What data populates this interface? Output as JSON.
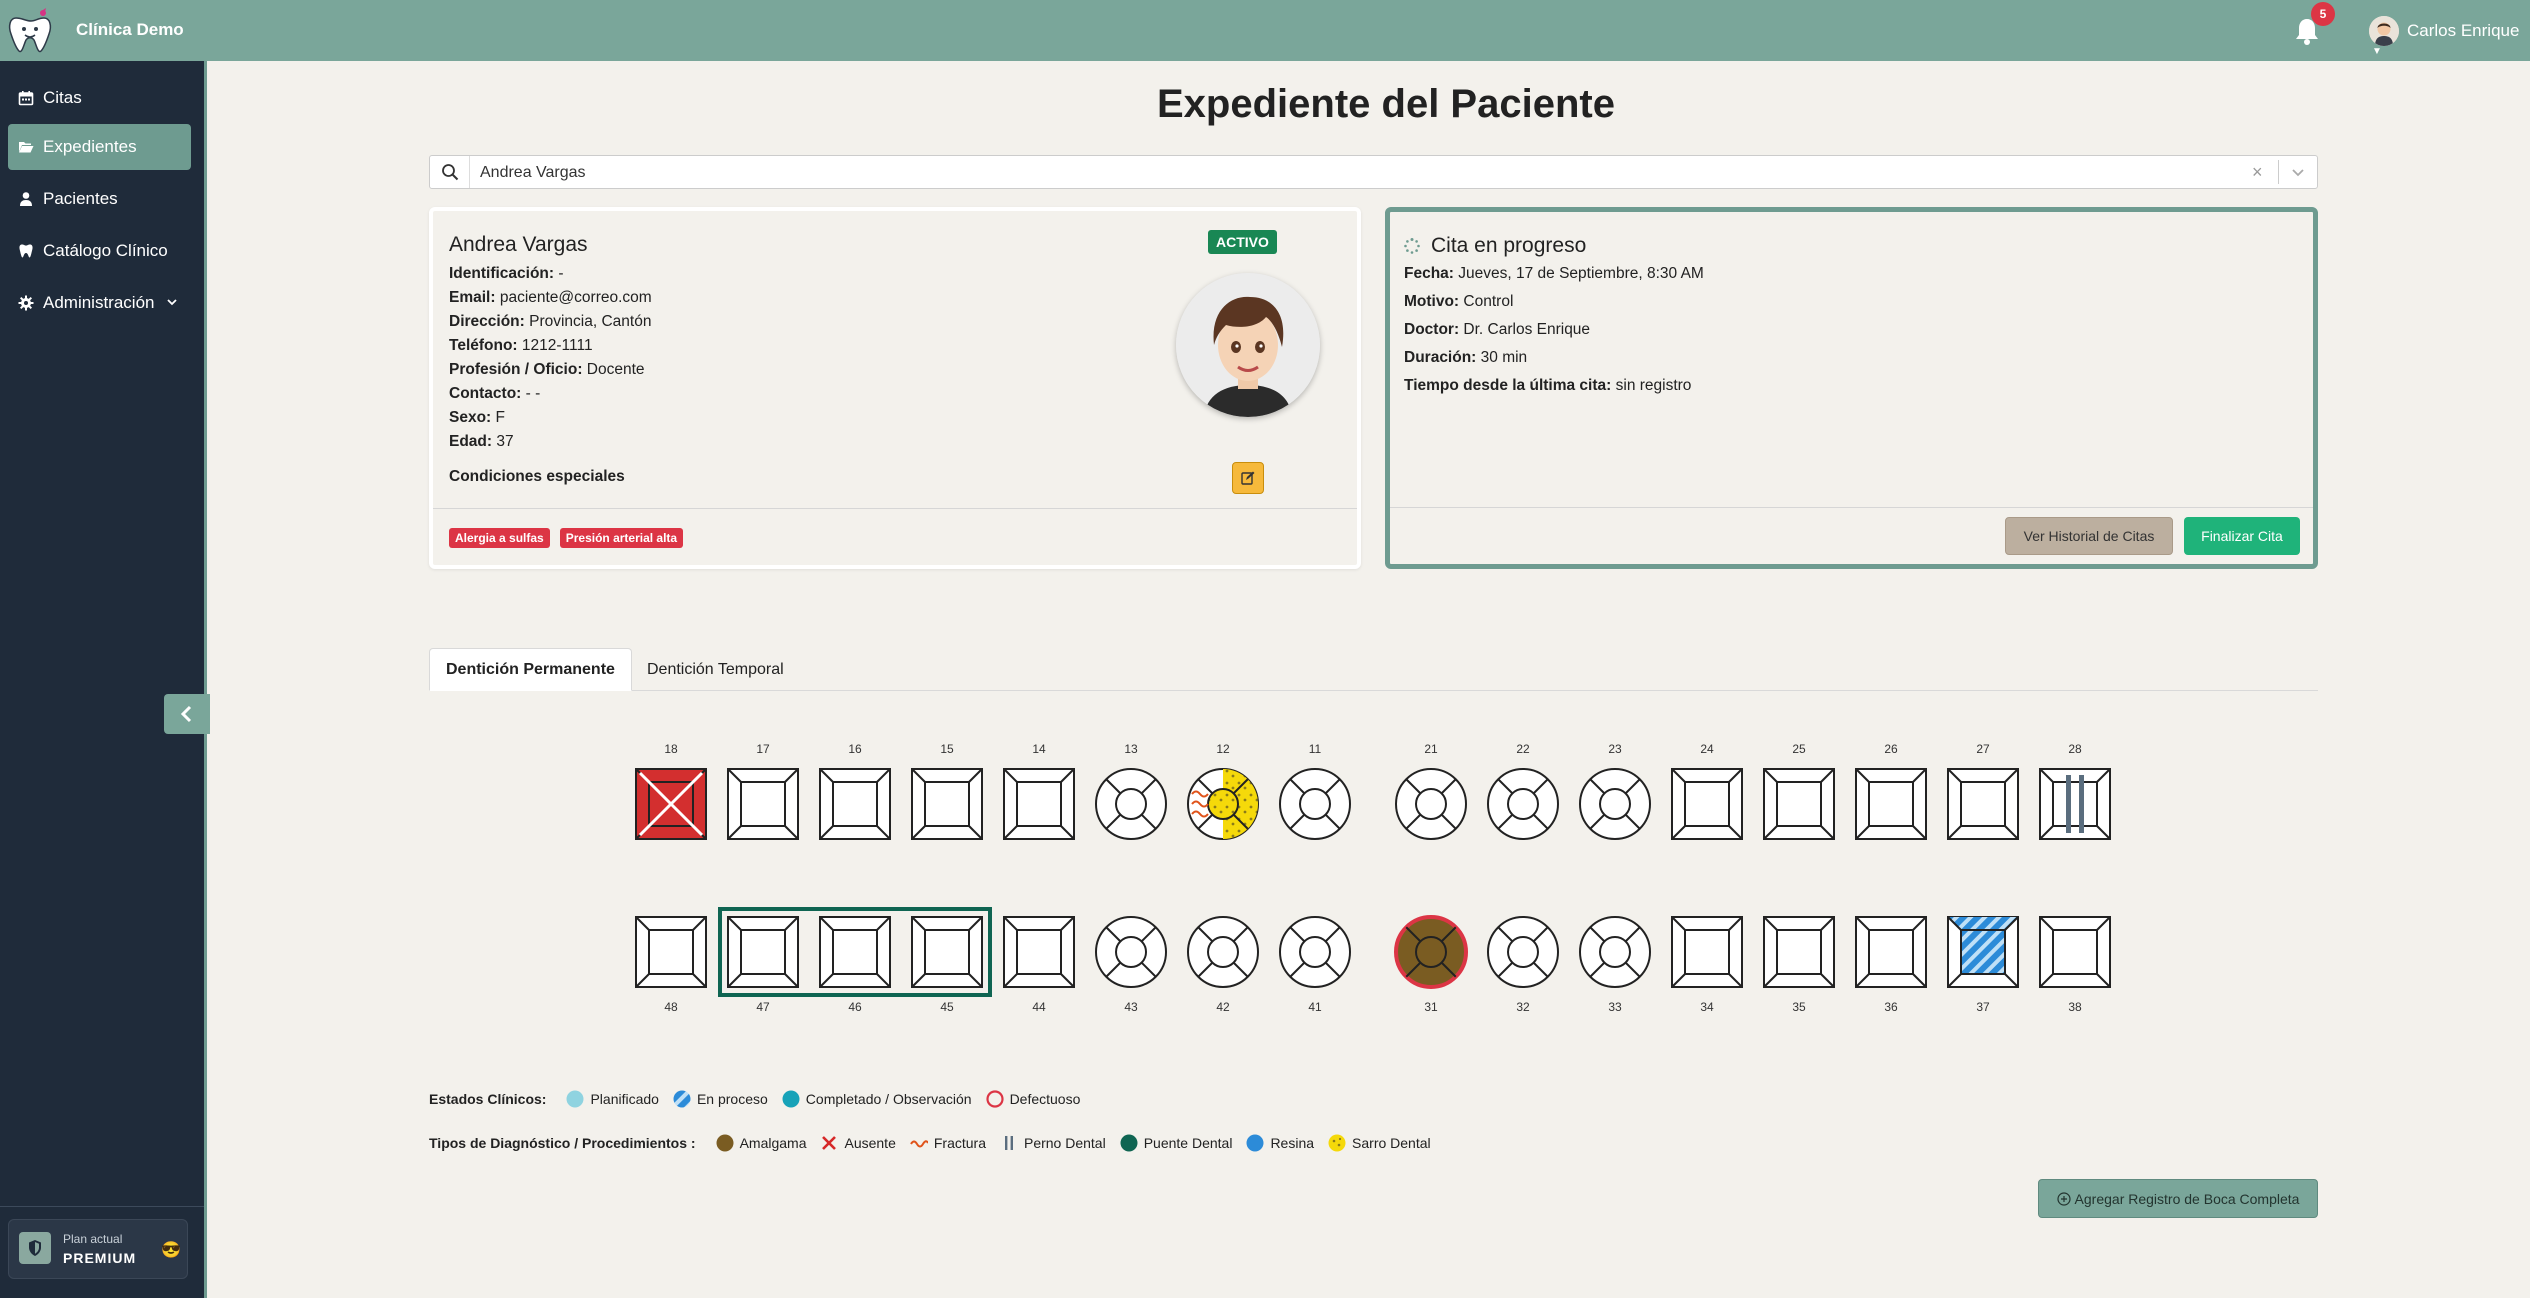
{
  "app": {
    "brand": "Clínica Demo",
    "notifications_count": "5",
    "user_name": "Carlos Enrique"
  },
  "sidebar": {
    "items": [
      {
        "label": "Citas",
        "icon": "calendar-icon"
      },
      {
        "label": "Expedientes",
        "icon": "folder-open-icon",
        "active": true
      },
      {
        "label": "Pacientes",
        "icon": "user-icon"
      },
      {
        "label": "Catálogo Clínico",
        "icon": "tooth-icon"
      },
      {
        "label": "Administración",
        "icon": "gear-icon"
      }
    ],
    "plan_label": "Plan actual",
    "plan_value": "PREMIUM"
  },
  "page": {
    "title": "Expediente del Paciente",
    "search_value": "Andrea Vargas"
  },
  "patient": {
    "name": "Andrea Vargas",
    "status": "ACTIVO",
    "fields": [
      {
        "label": "Identificación:",
        "value": " -"
      },
      {
        "label": "Email:",
        "value": " paciente@correo.com"
      },
      {
        "label": "Dirección:",
        "value": " Provincia, Cantón"
      },
      {
        "label": "Teléfono:",
        "value": " 1212-1111"
      },
      {
        "label": "Profesión / Oficio:",
        "value": " Docente"
      },
      {
        "label": "Contacto:",
        "value": " - -"
      },
      {
        "label": "Sexo:",
        "value": " F"
      },
      {
        "label": "Edad:",
        "value": " 37"
      }
    ],
    "conditions_title": "Condiciones especiales",
    "conditions": [
      "Alergia a sulfas",
      "Presión arterial alta"
    ]
  },
  "appointment": {
    "title": "Cita en progreso",
    "fields": [
      {
        "label": "Fecha:",
        "value": " Jueves, 17 de Septiembre, 8:30 AM"
      },
      {
        "label": "Motivo:",
        "value": " Control"
      },
      {
        "label": "Doctor:",
        "value": " Dr. Carlos Enrique"
      },
      {
        "label": "Duración:",
        "value": " 30 min"
      },
      {
        "label": "Tiempo desde la última cita:",
        "value": " sin registro"
      }
    ],
    "history_button": "Ver Historial de Citas",
    "finish_button": "Finalizar Cita"
  },
  "tabs": [
    {
      "label": "Dentición Permanente",
      "active": true
    },
    {
      "label": "Dentición Temporal",
      "active": false
    }
  ],
  "odontogram": {
    "upper": [
      {
        "n": "18",
        "shape": "square",
        "state": "ausente"
      },
      {
        "n": "17",
        "shape": "square"
      },
      {
        "n": "16",
        "shape": "square"
      },
      {
        "n": "15",
        "shape": "square"
      },
      {
        "n": "14",
        "shape": "square"
      },
      {
        "n": "13",
        "shape": "circle"
      },
      {
        "n": "12",
        "shape": "circle",
        "state": "sarro-fractura"
      },
      {
        "n": "11",
        "shape": "circle"
      },
      {
        "n": "21",
        "shape": "circle"
      },
      {
        "n": "22",
        "shape": "circle"
      },
      {
        "n": "23",
        "shape": "circle"
      },
      {
        "n": "24",
        "shape": "square"
      },
      {
        "n": "25",
        "shape": "square"
      },
      {
        "n": "26",
        "shape": "square"
      },
      {
        "n": "27",
        "shape": "square"
      },
      {
        "n": "28",
        "shape": "square",
        "state": "perno"
      }
    ],
    "lower": [
      {
        "n": "48",
        "shape": "square"
      },
      {
        "n": "47",
        "shape": "square"
      },
      {
        "n": "46",
        "shape": "square"
      },
      {
        "n": "45",
        "shape": "square"
      },
      {
        "n": "44",
        "shape": "square"
      },
      {
        "n": "43",
        "shape": "circle"
      },
      {
        "n": "42",
        "shape": "circle"
      },
      {
        "n": "41",
        "shape": "circle"
      },
      {
        "n": "31",
        "shape": "circle",
        "state": "amalgama-defectuoso"
      },
      {
        "n": "32",
        "shape": "circle"
      },
      {
        "n": "33",
        "shape": "circle"
      },
      {
        "n": "34",
        "shape": "square"
      },
      {
        "n": "35",
        "shape": "square"
      },
      {
        "n": "36",
        "shape": "square"
      },
      {
        "n": "37",
        "shape": "square",
        "state": "resina-proceso"
      },
      {
        "n": "38",
        "shape": "square"
      }
    ],
    "bridge_teeth": [
      "47",
      "46",
      "45"
    ]
  },
  "legend": {
    "states_title": "Estados Clínicos:",
    "states": [
      {
        "label": "Planificado",
        "symbol": "dot",
        "color": "#8fd3e0"
      },
      {
        "label": "En proceso",
        "symbol": "striped",
        "color": "#2c8bd8"
      },
      {
        "label": "Completado / Observación",
        "symbol": "dot",
        "color": "#17a2b8"
      },
      {
        "label": "Defectuoso",
        "symbol": "ring",
        "color": "#dc3545"
      }
    ],
    "types_title": "Tipos de Diagnóstico / Procedimientos :",
    "types": [
      {
        "label": "Amalgama",
        "symbol": "dot",
        "color": "#7a5c22"
      },
      {
        "label": "Ausente",
        "symbol": "x",
        "color": "#d62828"
      },
      {
        "label": "Fractura",
        "symbol": "wave",
        "color": "#e0541b"
      },
      {
        "label": "Perno Dental",
        "symbol": "bars",
        "color": "#5a6d7e"
      },
      {
        "label": "Puente Dental",
        "symbol": "dot",
        "color": "#0f6552"
      },
      {
        "label": "Resina",
        "symbol": "dot",
        "color": "#2c8bd8"
      },
      {
        "label": "Sarro Dental",
        "symbol": "sarro",
        "color": "#f5d90a"
      }
    ]
  },
  "actions": {
    "add_full_mouth": "Agregar Registro de Boca Completa"
  }
}
